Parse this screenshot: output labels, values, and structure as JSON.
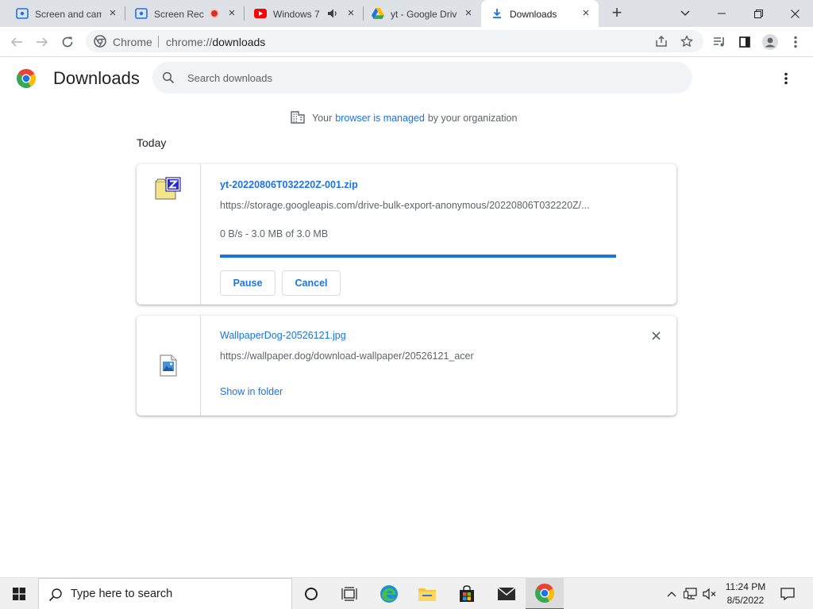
{
  "tabs": [
    {
      "title": "Screen and cam",
      "icon": "screencast-icon"
    },
    {
      "title": "Screen Rec",
      "icon": "screencast-icon",
      "recording": true
    },
    {
      "title": "Windows 7",
      "icon": "youtube-icon",
      "audio": true
    },
    {
      "title": "yt - Google Driv",
      "icon": "google-drive-icon"
    },
    {
      "title": "Downloads",
      "icon": "download-icon",
      "active": true
    }
  ],
  "omnibox": {
    "site_label": "Chrome",
    "url_scheme": "chrome://",
    "url_path": "downloads"
  },
  "page": {
    "title": "Downloads",
    "search_placeholder": "Search downloads"
  },
  "managed_notice": {
    "prefix": "Your",
    "link": "browser is managed",
    "suffix": "by your organization"
  },
  "section_label": "Today",
  "downloads": [
    {
      "filename": "yt-20220806T032220Z-001.zip",
      "url": "https://storage.googleapis.com/drive-bulk-export-anonymous/20220806T032220Z/...",
      "status": "0 B/s - 3.0 MB of 3.0 MB",
      "progress_percent": 100,
      "pause_label": "Pause",
      "cancel_label": "Cancel",
      "icon": "zip-file-icon"
    },
    {
      "filename": "WallpaperDog-20526121.jpg",
      "url": "https://wallpaper.dog/download-wallpaper/20526121_acer",
      "action_label": "Show in folder",
      "icon": "image-file-icon"
    }
  ],
  "taskbar": {
    "search_placeholder": "Type here to search",
    "time": "11:24 PM",
    "date": "8/5/2022"
  },
  "colors": {
    "accent": "#1a73e8",
    "tab_strip": "#dee1e6",
    "omnibox_bg": "#f1f3f4"
  }
}
